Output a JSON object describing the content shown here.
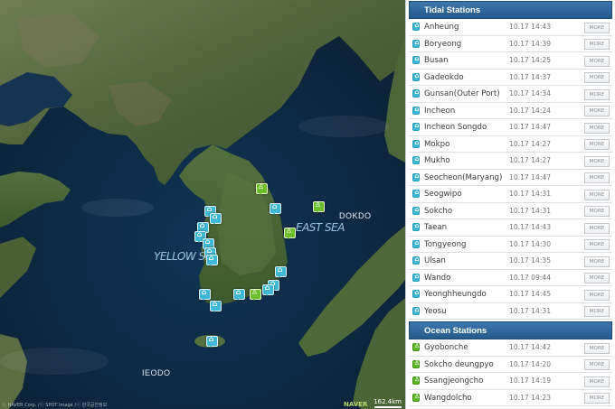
{
  "map": {
    "labels": {
      "yellow_sea": "YELLOW SEA",
      "east_sea": "EAST SEA",
      "dokdo": "DOKDO",
      "ieodo": "IEODO"
    },
    "scale": "162.4km",
    "logo": "NAVER",
    "copyright": "ⓒ NAVER Corp. /ⓒ SPOT Image /ⓒ 한국공간정보"
  },
  "colors": {
    "tidal_marker": "#3fb8d8",
    "ocean_marker": "#6cbf2a",
    "header_blue": "#2f66a0"
  },
  "panel": {
    "tidal": {
      "title": "Tidal Stations",
      "icon": "tide-station-icon",
      "items": [
        {
          "name": "Anheung",
          "time": "10.17 14:43",
          "more": "MORE"
        },
        {
          "name": "Boryeong",
          "time": "10.17 14:39",
          "more": "MORE"
        },
        {
          "name": "Busan",
          "time": "10.17 14:25",
          "more": "MORE"
        },
        {
          "name": "Gadeokdo",
          "time": "10.17 14:37",
          "more": "MORE"
        },
        {
          "name": "Gunsan(Outer Port)",
          "time": "10.17 14:34",
          "more": "MORE"
        },
        {
          "name": "Incheon",
          "time": "10.17 14:24",
          "more": "MORE"
        },
        {
          "name": "Incheon Songdo",
          "time": "10.17 14:47",
          "more": "MORE"
        },
        {
          "name": "Mokpo",
          "time": "10.17 14:27",
          "more": "MORE"
        },
        {
          "name": "Mukho",
          "time": "10.17 14:27",
          "more": "MORE"
        },
        {
          "name": "Seocheon(Maryang)",
          "time": "10.17 14:47",
          "more": "MORE"
        },
        {
          "name": "Seogwipo",
          "time": "10.17 14:31",
          "more": "MORE"
        },
        {
          "name": "Sokcho",
          "time": "10.17 14:31",
          "more": "MORE"
        },
        {
          "name": "Taean",
          "time": "10.17 14:43",
          "more": "MORE"
        },
        {
          "name": "Tongyeong",
          "time": "10.17 14:30",
          "more": "MORE"
        },
        {
          "name": "Ulsan",
          "time": "10.17 14:35",
          "more": "MORE"
        },
        {
          "name": "Wando",
          "time": "10.17 09:44",
          "more": "MORE"
        },
        {
          "name": "Yeonghheungdo",
          "time": "10.17 14:45",
          "more": "MORE"
        },
        {
          "name": "Yeosu",
          "time": "10.17 14:31",
          "more": "MORE"
        }
      ]
    },
    "ocean": {
      "title": "Ocean Stations",
      "icon": "ocean-station-icon",
      "items": [
        {
          "name": "Gyobonche",
          "time": "10.17 14:42",
          "more": "MORE"
        },
        {
          "name": "Sokcho deungpyo",
          "time": "10.17 14:20",
          "more": "MORE"
        },
        {
          "name": "Ssangjeongcho",
          "time": "10.17 14:19",
          "more": "MORE"
        },
        {
          "name": "Wangdolcho",
          "time": "10.17 14:23",
          "more": "MORE"
        }
      ]
    }
  }
}
